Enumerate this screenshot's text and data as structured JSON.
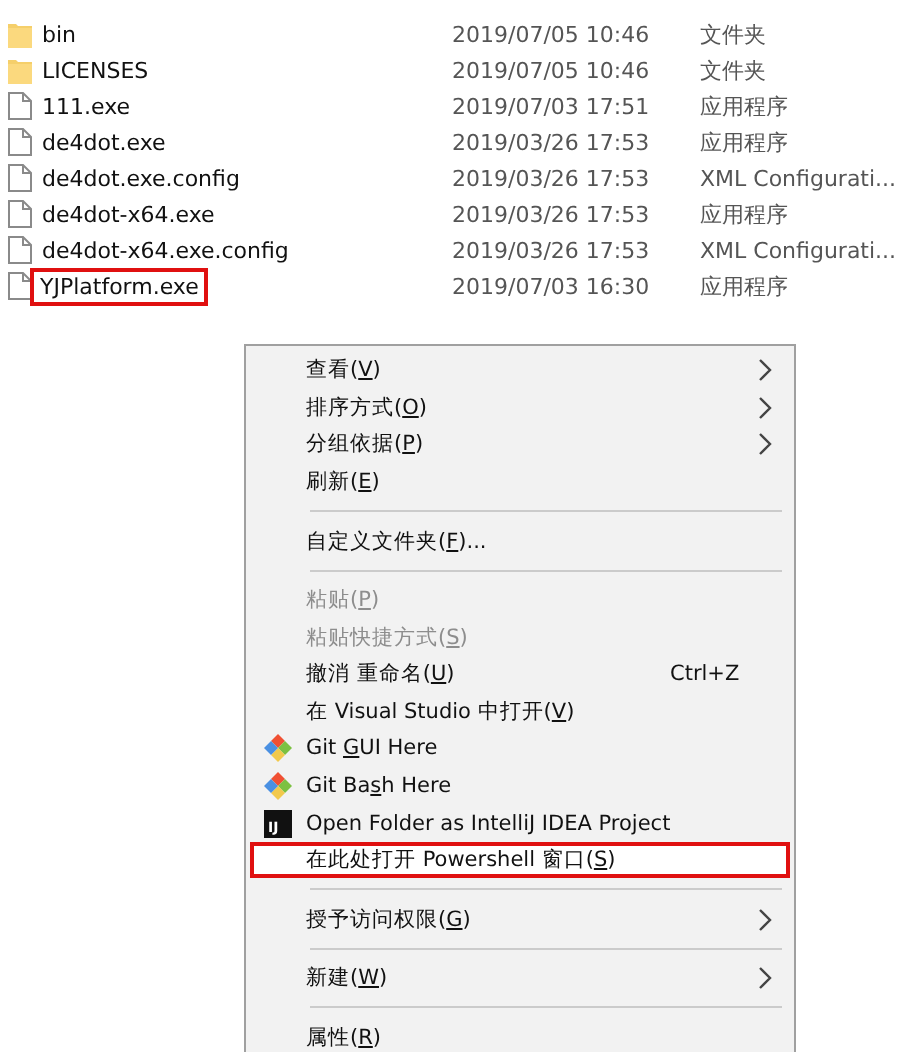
{
  "files": [
    {
      "name": "bin",
      "date": "2019/07/05 10:46",
      "type": "文件夹",
      "kind": "folder",
      "annotated": false
    },
    {
      "name": "LICENSES",
      "date": "2019/07/05 10:46",
      "type": "文件夹",
      "kind": "folder",
      "annotated": false
    },
    {
      "name": "111.exe",
      "date": "2019/07/03 17:51",
      "type": "应用程序",
      "kind": "file",
      "annotated": false
    },
    {
      "name": "de4dot.exe",
      "date": "2019/03/26 17:53",
      "type": "应用程序",
      "kind": "file",
      "annotated": false
    },
    {
      "name": "de4dot.exe.config",
      "date": "2019/03/26 17:53",
      "type": "XML Configurati...",
      "kind": "file",
      "annotated": false
    },
    {
      "name": "de4dot-x64.exe",
      "date": "2019/03/26 17:53",
      "type": "应用程序",
      "kind": "file",
      "annotated": false
    },
    {
      "name": "de4dot-x64.exe.config",
      "date": "2019/03/26 17:53",
      "type": "XML Configurati...",
      "kind": "file",
      "annotated": false
    },
    {
      "name": "YJPlatform.exe",
      "date": "2019/07/03 16:30",
      "type": "应用程序",
      "kind": "file",
      "annotated": true
    }
  ],
  "menu": [
    {
      "kind": "item",
      "before": "查看(",
      "key": "V",
      "after": ")",
      "submenu": true,
      "disabled": false,
      "selected": false
    },
    {
      "kind": "item",
      "before": "排序方式(",
      "key": "O",
      "after": ")",
      "submenu": true,
      "disabled": false,
      "selected": false
    },
    {
      "kind": "item",
      "before": "分组依据(",
      "key": "P",
      "after": ")",
      "submenu": true,
      "disabled": false,
      "selected": false
    },
    {
      "kind": "item",
      "before": "刷新(",
      "key": "E",
      "after": ")",
      "submenu": false,
      "disabled": false,
      "selected": false
    },
    {
      "kind": "separator"
    },
    {
      "kind": "item",
      "before": "自定义文件夹(",
      "key": "F",
      "after": ")...",
      "submenu": false,
      "disabled": false,
      "selected": false
    },
    {
      "kind": "separator"
    },
    {
      "kind": "item",
      "before": "粘贴(",
      "key": "P",
      "after": ")",
      "submenu": false,
      "disabled": true,
      "selected": false
    },
    {
      "kind": "item",
      "before": "粘贴快捷方式(",
      "key": "S",
      "after": ")",
      "submenu": false,
      "disabled": true,
      "selected": false
    },
    {
      "kind": "item",
      "before": "撤消 重命名(",
      "key": "U",
      "after": ")",
      "shortcut": "Ctrl+Z",
      "submenu": false,
      "disabled": false,
      "selected": false
    },
    {
      "kind": "item",
      "before": "在 Visual Studio 中打开(",
      "key": "V",
      "after": ")",
      "submenu": false,
      "disabled": false,
      "selected": false
    },
    {
      "kind": "git",
      "before": "Git ",
      "key": "G",
      "after": "UI Here",
      "submenu": false,
      "disabled": false,
      "selected": false
    },
    {
      "kind": "git",
      "before": "Git Ba",
      "key": "s",
      "after": "h Here",
      "submenu": false,
      "disabled": false,
      "selected": false
    },
    {
      "kind": "intellij",
      "icon_text": "IJ",
      "before": "Open Folder as IntelliJ IDEA Project",
      "submenu": false,
      "disabled": false,
      "selected": false
    },
    {
      "kind": "item",
      "before": "在此处打开 Powershell 窗口(",
      "key": "S",
      "after": ")",
      "submenu": false,
      "disabled": false,
      "selected": true,
      "annotated": true
    },
    {
      "kind": "separator"
    },
    {
      "kind": "item",
      "before": "授予访问权限(",
      "key": "G",
      "after": ")",
      "submenu": true,
      "disabled": false,
      "selected": false
    },
    {
      "kind": "separator"
    },
    {
      "kind": "item",
      "before": "新建(",
      "key": "W",
      "after": ")",
      "submenu": true,
      "disabled": false,
      "selected": false
    },
    {
      "kind": "separator"
    },
    {
      "kind": "item",
      "before": "属性(",
      "key": "R",
      "after": ")",
      "submenu": false,
      "disabled": false,
      "selected": false
    }
  ]
}
